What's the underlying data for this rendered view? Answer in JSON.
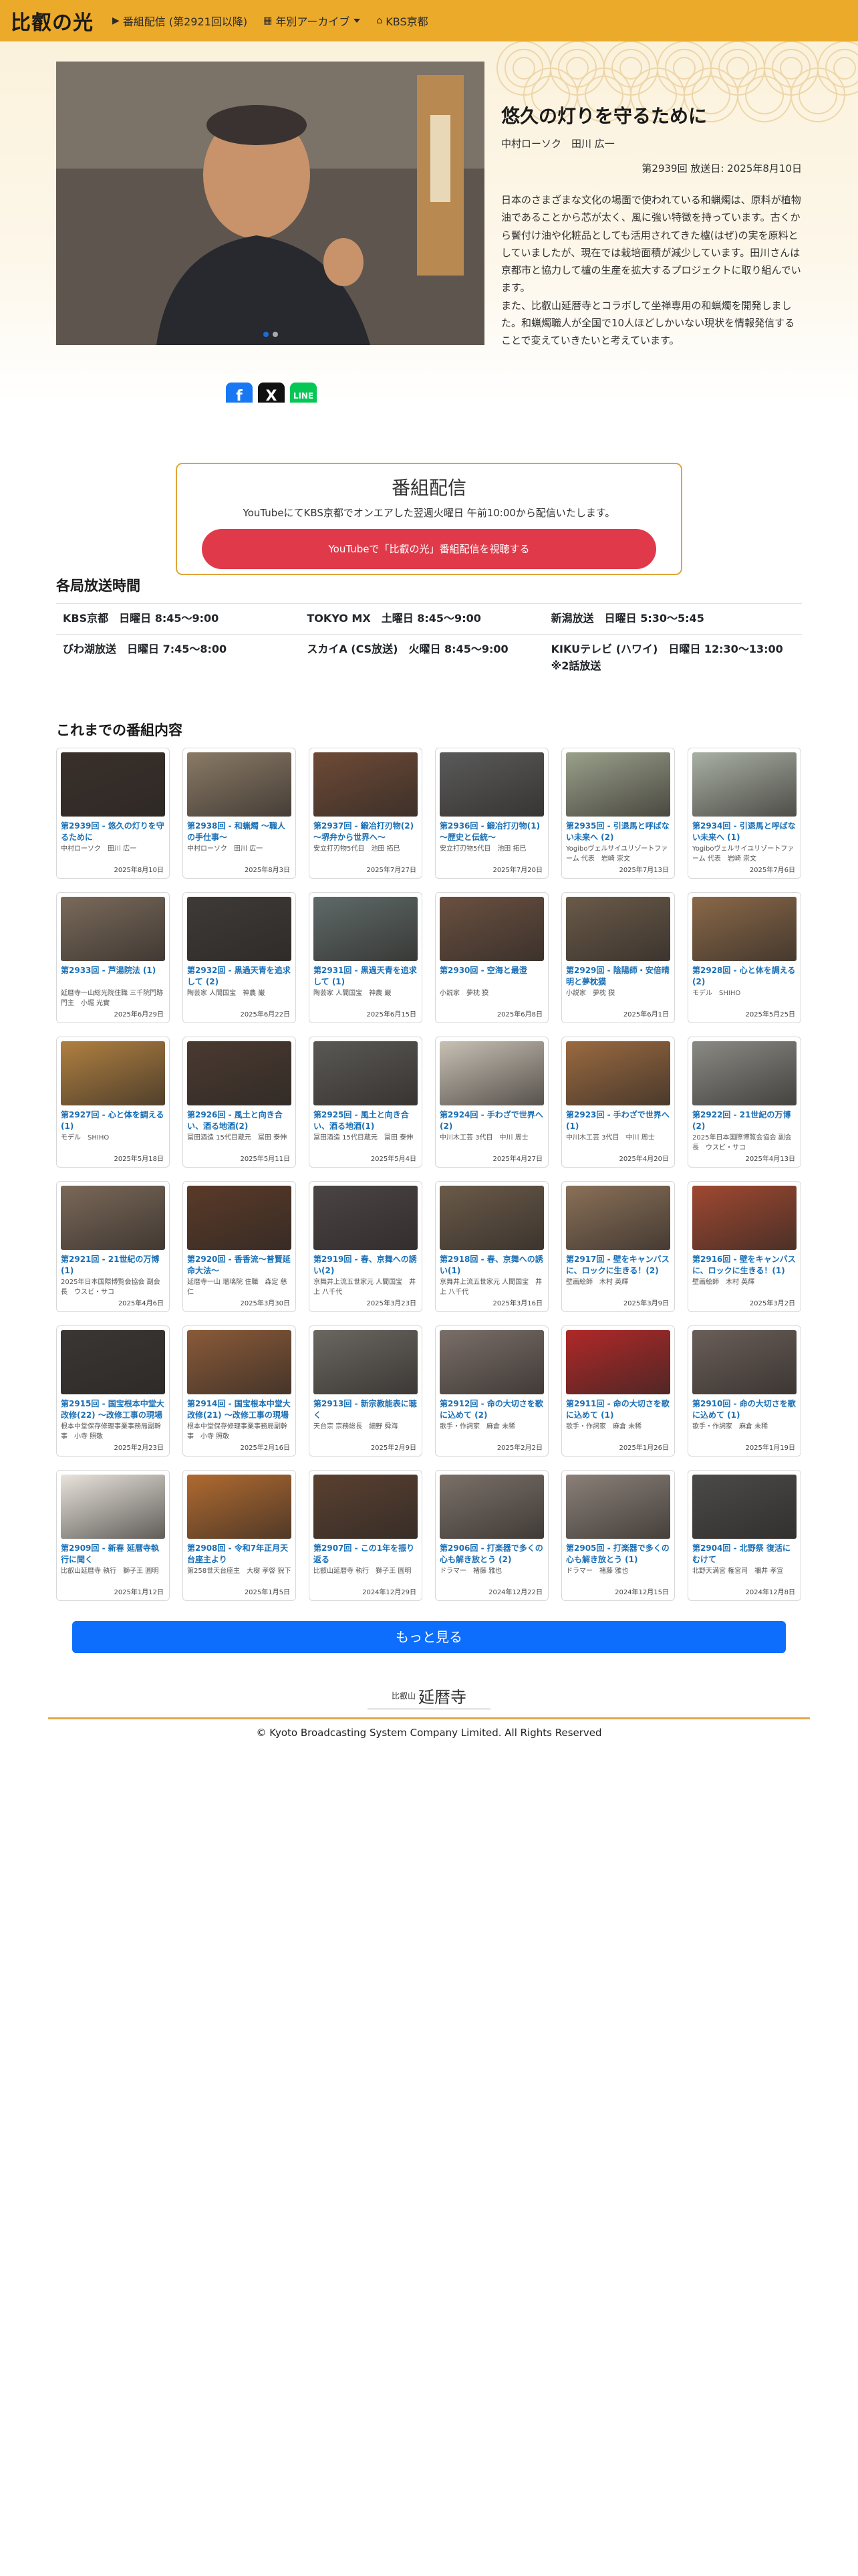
{
  "nav": {
    "brand": "比叡の光",
    "item_live": "番組配信 (第2921回以降)",
    "item_archive": "年別アーカイブ",
    "item_kbs": "KBS京都"
  },
  "hero": {
    "title": "悠久の灯りを守るために",
    "guests": "中村ローソク　田川 広一",
    "meta": "第2939回 放送日: 2025年8月10日",
    "description": "日本のさまざまな文化の場面で使われている和蝋燭は、原料が植物油であることから芯が太く、風に強い特徴を持っています。古くから鬢付け油や化粧品としても活用されてきた櫨(はぜ)の実を原料としていましたが、現在では栽培面積が減少しています。田川さんは京都市と協力して櫨の生産を拡大するプロジェクトに取り組んでいます。\nまた、比叡山延暦寺とコラボして坐禅専用の和蝋燭を開発しました。和蝋燭職人が全国で10人ほどしかいない現状を情報発信することで変えていきたいと考えています。",
    "share_fb": "f",
    "share_x": "X",
    "share_line": "LINE"
  },
  "streaming": {
    "heading": "番組配信",
    "text": "YouTubeにてKBS京都でオンエアした翌週火曜日 午前10:00から配信いたします。",
    "button": "YouTubeで「比叡の光」番組配信を視聴する"
  },
  "broadcast": {
    "heading": "各局放送時間",
    "stations": [
      "KBS京都　日曜日 8:45〜9:00",
      "TOKYO MX　土曜日 8:45〜9:00",
      "新潟放送　日曜日 5:30〜5:45",
      "びわ湖放送　日曜日 7:45〜8:00",
      "スカイA (CS放送)　火曜日 8:45〜9:00",
      "KIKUテレビ (ハワイ)　日曜日 12:30〜13:00\n※2話放送"
    ]
  },
  "archive": {
    "heading": "これまでの番組内容",
    "episodes": [
      {
        "title": "第2939回 - 悠久の灯りを守るために",
        "guest": "中村ローソク　田川 広一",
        "date": "2025年8月10日",
        "color": "#3a302a"
      },
      {
        "title": "第2938回 - 和蝋燭 〜職人の手仕事〜",
        "guest": "中村ローソク　田川 広一",
        "date": "2025年8月3日",
        "color": "#8a7a66"
      },
      {
        "title": "第2937回 - 鍛冶打刃物(2) 〜堺弁から世界へ〜",
        "guest": "安立打刃物5代目　池田 拓巳",
        "date": "2025年7月27日",
        "color": "#6e4a36"
      },
      {
        "title": "第2936回 - 鍛冶打刃物(1) 〜歴史と伝統〜",
        "guest": "安立打刃物5代目　池田 拓巳",
        "date": "2025年7月20日",
        "color": "#5a5a5a"
      },
      {
        "title": "第2935回 - 引退馬と呼ばない未来へ (2)",
        "guest": "Yogiboヴェルサイユリゾートファーム 代表　岩崎 崇文",
        "date": "2025年7月13日",
        "color": "#9aa08a"
      },
      {
        "title": "第2934回 - 引退馬と呼ばない未来へ (1)",
        "guest": "Yogiboヴェルサイユリゾートファーム 代表　岩崎 崇文",
        "date": "2025年7月6日",
        "color": "#a9b0a4"
      },
      {
        "title": "第2933回 - 芦湯院法 (1)",
        "guest": "延暦寺一山総光院住職 三千院門跡門主　小堀 光實",
        "date": "2025年6月29日",
        "color": "#7a6a5a"
      },
      {
        "title": "第2932回 - 黒過天青を追求して (2)",
        "guest": "陶芸家 人間国宝　神農 巌",
        "date": "2025年6月22日",
        "color": "#3d3a38"
      },
      {
        "title": "第2931回 - 黒過天青を追求して (1)",
        "guest": "陶芸家 人間国宝　神農 巌",
        "date": "2025年6月15日",
        "color": "#5e6a68"
      },
      {
        "title": "第2930回 - 空海と最澄",
        "guest": "小説家　夢枕 獏",
        "date": "2025年6月8日",
        "color": "#6a5040"
      },
      {
        "title": "第2929回 - 陰陽師・安倍晴明と夢枕獏",
        "guest": "小説家　夢枕 獏",
        "date": "2025年6月1日",
        "color": "#6a5a48"
      },
      {
        "title": "第2928回 - 心と体を調える(2)",
        "guest": "モデル　SHIHO",
        "date": "2025年5月25日",
        "color": "#8a6848"
      },
      {
        "title": "第2927回 - 心と体を調える(1)",
        "guest": "モデル　SHIHO",
        "date": "2025年5月18日",
        "color": "#b08040"
      },
      {
        "title": "第2926回 - 風土と向き合い、酒る地酒(2)",
        "guest": "冨田酒造 15代目蔵元　冨田 泰伸",
        "date": "2025年5月11日",
        "color": "#4a3a30"
      },
      {
        "title": "第2925回 - 風土と向き合い、酒る地酒(1)",
        "guest": "冨田酒造 15代目蔵元　冨田 泰伸",
        "date": "2025年5月4日",
        "color": "#5a5854"
      },
      {
        "title": "第2924回 - 手わざで世界へ(2)",
        "guest": "中川木工芸 3代目　中川 周士",
        "date": "2025年4月27日",
        "color": "#c8c0b4"
      },
      {
        "title": "第2923回 - 手わざで世界へ(1)",
        "guest": "中川木工芸 3代目　中川 周士",
        "date": "2025年4月20日",
        "color": "#9a6a40"
      },
      {
        "title": "第2922回 - 21世紀の万博 (2)",
        "guest": "2025年日本国際博覧会協会 副会長　ウスビ・サコ",
        "date": "2025年4月13日",
        "color": "#8a8a84"
      },
      {
        "title": "第2921回 - 21世紀の万博 (1)",
        "guest": "2025年日本国際博覧会協会 副会長　ウスビ・サコ",
        "date": "2025年4月6日",
        "color": "#7a6858"
      },
      {
        "title": "第2920回 - 香香流〜普賢延命大法〜",
        "guest": "延暦寺一山 瑠璃院 住職　森定 慈仁",
        "date": "2025年3月30日",
        "color": "#5a3a28"
      },
      {
        "title": "第2919回 - 春、京舞への誘い(2)",
        "guest": "京舞井上流五世家元 人間国宝　井上 八千代",
        "date": "2025年3月23日",
        "color": "#4a4444"
      },
      {
        "title": "第2918回 - 春、京舞への誘い(1)",
        "guest": "京舞井上流五世家元 人間国宝　井上 八千代",
        "date": "2025年3月16日",
        "color": "#6a5a48"
      },
      {
        "title": "第2917回 - 壁をキャンバスに、ロックに生きる！(2)",
        "guest": "壁画絵師　木村 英輝",
        "date": "2025年3月9日",
        "color": "#8a7058"
      },
      {
        "title": "第2916回 - 壁をキャンバスに、ロックに生きる！(1)",
        "guest": "壁画絵師　木村 英輝",
        "date": "2025年3月2日",
        "color": "#a04830"
      },
      {
        "title": "第2915回 - 国宝根本中堂大改修(22) 〜改修工事の現場から〜",
        "guest": "根本中堂保存修理事業事務局副幹事　小寺 照敬",
        "date": "2025年2月23日",
        "color": "#3a3634"
      },
      {
        "title": "第2914回 - 国宝根本中堂大改修(21) 〜改修工事の現場から〜",
        "guest": "根本中堂保存修理事業事務局副幹事　小寺 照敬",
        "date": "2025年2月16日",
        "color": "#8a5a38"
      },
      {
        "title": "第2913回 - 新宗教能表に聴く",
        "guest": "天台宗 宗務総長　細野 舜海",
        "date": "2025年2月9日",
        "color": "#6a6660"
      },
      {
        "title": "第2912回 - 命の大切さを歌に込めて (2)",
        "guest": "歌手・作詞家　麻倉 未稀",
        "date": "2025年2月2日",
        "color": "#7a6e68"
      },
      {
        "title": "第2911回 - 命の大切さを歌に込めて (1)",
        "guest": "歌手・作詞家　麻倉 未稀",
        "date": "2025年1月26日",
        "color": "#b02828"
      },
      {
        "title": "第2910回 - 命の大切さを歌に込めて (1)",
        "guest": "歌手・作詞家　麻倉 未稀",
        "date": "2025年1月19日",
        "color": "#6a5e58"
      },
      {
        "title": "第2909回 - 新春 延暦寺執行に聞く",
        "guest": "比叡山延暦寺 執行　獅子王 圓明",
        "date": "2025年1月12日",
        "color": "#e8e4dc"
      },
      {
        "title": "第2908回 - 令和7年正月天台座主より",
        "guest": "第258世天台座主　大樹 孝啓 猊下",
        "date": "2025年1月5日",
        "color": "#b06a30"
      },
      {
        "title": "第2907回 - この1年を振り返る",
        "guest": "比叡山延暦寺 執行　獅子王 圓明",
        "date": "2024年12月29日",
        "color": "#5a4030"
      },
      {
        "title": "第2906回 - 打楽器で多くの心も解き放とう (2)",
        "guest": "ドラマー　褚藤 雅也",
        "date": "2024年12月22日",
        "color": "#7a7068"
      },
      {
        "title": "第2905回 - 打楽器で多くの心も解き放とう (1)",
        "guest": "ドラマー　褚藤 雅也",
        "date": "2024年12月15日",
        "color": "#8a8078"
      },
      {
        "title": "第2904回 - 北野祭 復活にむけて",
        "guest": "北野天満宮 権宮司　禰井 孝宣",
        "date": "2024年12月8日",
        "color": "#4a4a48"
      }
    ],
    "more_button": "もっと見る"
  },
  "footer": {
    "logo_small": "比叡山",
    "logo_main": "延暦寺",
    "copyright": "© Kyoto Broadcasting System Company Limited. All Rights Reserved"
  }
}
